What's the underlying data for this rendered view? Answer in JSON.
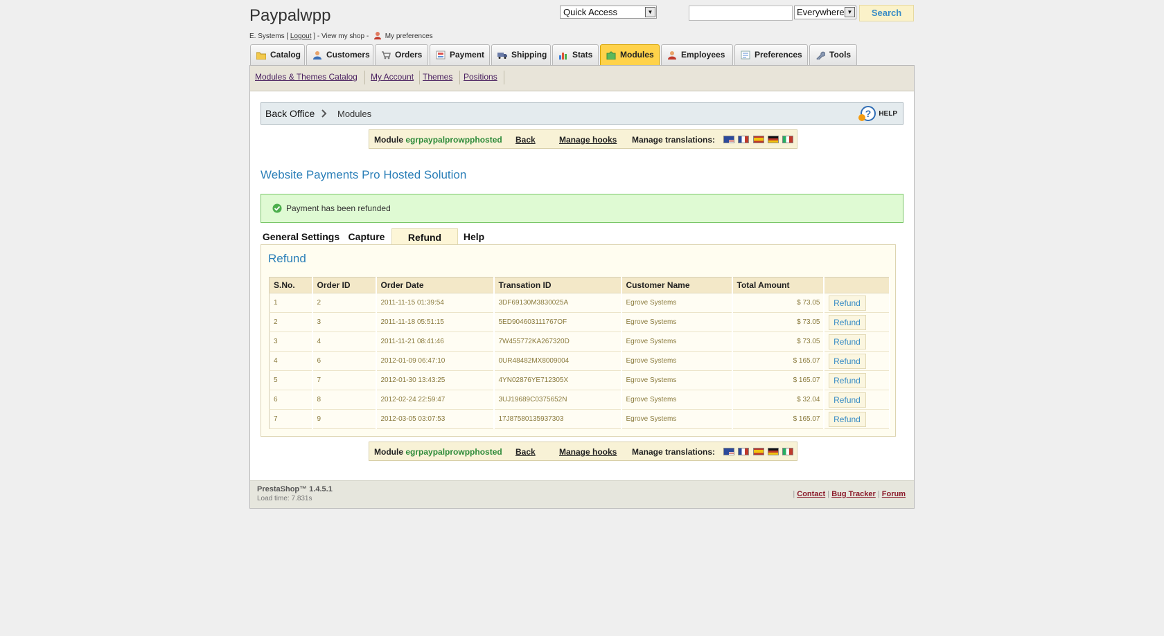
{
  "header": {
    "shop_title": "Paypalwpp",
    "user_name": "E. Systems",
    "logout_label": "Logout",
    "view_shop_label": "View my shop",
    "preferences_label": "My preferences",
    "quick_access_label": "Quick Access",
    "search_value": "",
    "search_scope": "Everywhere",
    "search_button": "Search"
  },
  "main_tabs": [
    {
      "label": "Catalog",
      "icon": "folder-icon"
    },
    {
      "label": "Customers",
      "icon": "customer-icon"
    },
    {
      "label": "Orders",
      "icon": "cart-icon"
    },
    {
      "label": "Payment",
      "icon": "payment-icon"
    },
    {
      "label": "Shipping",
      "icon": "truck-icon"
    },
    {
      "label": "Stats",
      "icon": "bar-chart-icon"
    },
    {
      "label": "Modules",
      "icon": "puzzle-icon",
      "active": true
    },
    {
      "label": "Employees",
      "icon": "employee-icon"
    },
    {
      "label": "Preferences",
      "icon": "preferences-icon"
    },
    {
      "label": "Tools",
      "icon": "wrench-icon"
    }
  ],
  "subnav": [
    "Modules & Themes Catalog",
    "My Account",
    "Themes",
    "Positions"
  ],
  "breadcrumb": {
    "root": "Back Office",
    "current": "Modules",
    "help_label": "HELP"
  },
  "module_bar": {
    "module_label": "Module",
    "module_name": "egrpaypalprowpphosted",
    "back_label": "Back",
    "hooks_label": "Manage hooks",
    "translations_label": "Manage translations:"
  },
  "module_title": "Website Payments Pro Hosted Solution",
  "confirmation": "Payment has been refunded",
  "tabs": [
    {
      "label": "General Settings"
    },
    {
      "label": "Capture"
    },
    {
      "label": "Refund",
      "active": true
    },
    {
      "label": "Help"
    }
  ],
  "panel_title": "Refund",
  "table": {
    "columns": [
      "S.No.",
      "Order ID",
      "Order Date",
      "Transation ID",
      "Customer Name",
      "Total Amount",
      ""
    ],
    "rows": [
      [
        "1",
        "2",
        "2011-11-15 01:39:54",
        "3DF69130M3830025A",
        "Egrove Systems",
        "$ 73.05"
      ],
      [
        "2",
        "3",
        "2011-11-18 05:51:15",
        "5ED904603111767OF",
        "Egrove Systems",
        "$ 73.05"
      ],
      [
        "3",
        "4",
        "2011-11-21 08:41:46",
        "7W455772KA267320D",
        "Egrove Systems",
        "$ 73.05"
      ],
      [
        "4",
        "6",
        "2012-01-09 06:47:10",
        "0UR48482MX8009004",
        "Egrove Systems",
        "$ 165.07"
      ],
      [
        "5",
        "7",
        "2012-01-30 13:43:25",
        "4YN02876YE712305X",
        "Egrove Systems",
        "$ 165.07"
      ],
      [
        "6",
        "8",
        "2012-02-24 22:59:47",
        "3UJ19689C0375652N",
        "Egrove Systems",
        "$ 32.04"
      ],
      [
        "7",
        "9",
        "2012-03-05 03:07:53",
        "17J87580135937303",
        "Egrove Systems",
        "$ 165.07"
      ]
    ],
    "action_label": "Refund"
  },
  "footer": {
    "version": "PrestaShop™ 1.4.5.1",
    "load_time": "Load time: 7.831s",
    "links": [
      "Contact",
      "Bug Tracker",
      "Forum"
    ]
  },
  "colors": {
    "active_tab": "#ffd24a",
    "title_blue": "#2b7fb8",
    "module_green": "#2e8b3a",
    "confirm_bg": "#dffad3",
    "confirm_border": "#79c667",
    "panel_bg": "#fffdf0"
  }
}
